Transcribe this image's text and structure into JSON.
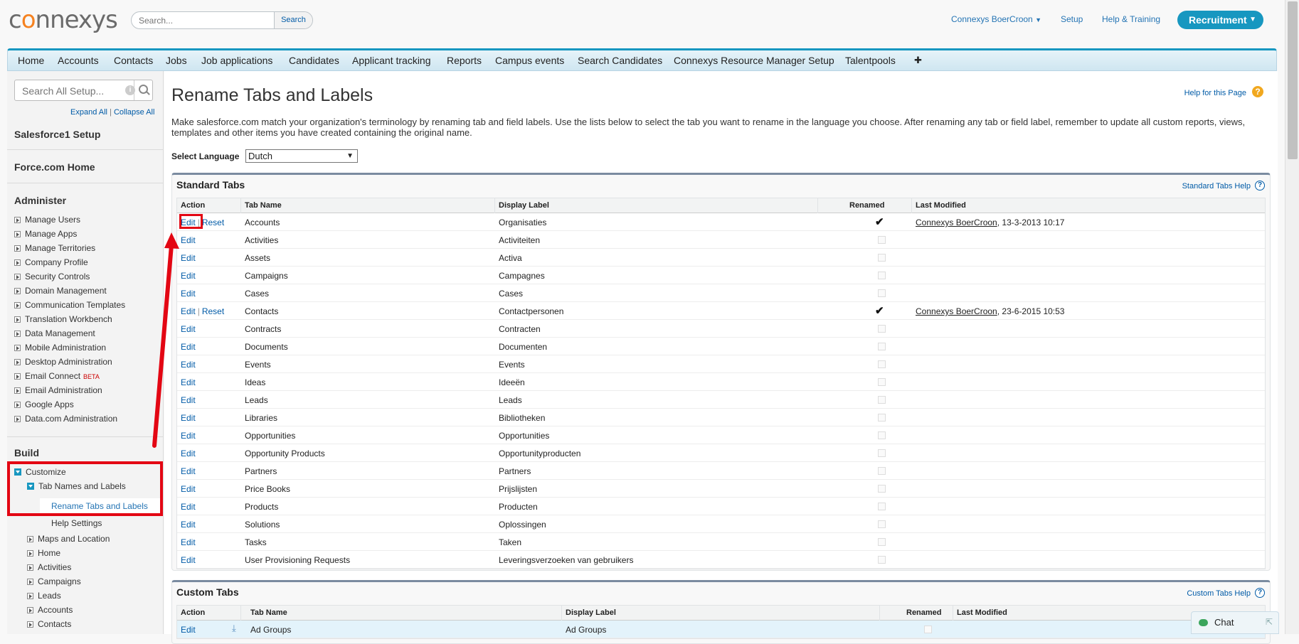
{
  "header": {
    "logo_text": "connexys",
    "search_placeholder": "Search...",
    "search_button": "Search",
    "user_menu": "Connexys BoerCroon",
    "setup": "Setup",
    "help_training": "Help & Training",
    "app_switcher": "Recruitment"
  },
  "tabs": [
    "Home",
    "Accounts",
    "Contacts",
    "Jobs",
    "Job applications",
    "Candidates",
    "Applicant tracking",
    "Reports",
    "Campus events",
    "Search Candidates",
    "Connexys Resource Manager Setup",
    "Talentpools",
    "✚"
  ],
  "sidebar": {
    "search_placeholder": "Search All Setup...",
    "expand_all": "Expand All",
    "collapse_all": "Collapse All",
    "salesforce1": "Salesforce1 Setup",
    "force_home": "Force.com Home",
    "administer_title": "Administer",
    "administer_items": [
      "Manage Users",
      "Manage Apps",
      "Manage Territories",
      "Company Profile",
      "Security Controls",
      "Domain Management",
      "Communication Templates",
      "Translation Workbench",
      "Data Management",
      "Mobile Administration",
      "Desktop Administration",
      "Email Connect",
      "Email Administration",
      "Google Apps",
      "Data.com Administration"
    ],
    "beta_badge": "BETA",
    "build_title": "Build",
    "customize": "Customize",
    "tab_names_labels": "Tab Names and Labels",
    "rename_tabs": "Rename Tabs and Labels",
    "help_settings": "Help Settings",
    "customize_items": [
      "Maps and Location",
      "Home",
      "Activities",
      "Campaigns",
      "Leads",
      "Accounts",
      "Contacts"
    ]
  },
  "main": {
    "title": "Rename Tabs and Labels",
    "help_page": "Help for this Page",
    "intro": "Make salesforce.com match your organization's terminology by renaming tab and field labels. Use the lists below to select the tab you want to rename in the language you choose. After renaming any tab or field label, remember to update all custom reports, views, templates and other items you have created containing the original name.",
    "select_language_label": "Select Language",
    "selected_language": "Dutch"
  },
  "standard_tabs": {
    "title": "Standard Tabs",
    "help": "Standard Tabs Help",
    "columns": [
      "Action",
      "Tab Name",
      "Display Label",
      "Renamed",
      "Last Modified"
    ],
    "edit_label": "Edit",
    "reset_label": "Reset",
    "rows": [
      {
        "tab": "Accounts",
        "label": "Organisaties",
        "renamed": true,
        "modified_by": "Connexys BoerCroon",
        "modified_at": ", 13-3-2013 10:17"
      },
      {
        "tab": "Activities",
        "label": "Activiteiten",
        "renamed": false
      },
      {
        "tab": "Assets",
        "label": "Activa",
        "renamed": false
      },
      {
        "tab": "Campaigns",
        "label": "Campagnes",
        "renamed": false
      },
      {
        "tab": "Cases",
        "label": "Cases",
        "renamed": false
      },
      {
        "tab": "Contacts",
        "label": "Contactpersonen",
        "renamed": true,
        "modified_by": "Connexys BoerCroon",
        "modified_at": ", 23-6-2015 10:53"
      },
      {
        "tab": "Contracts",
        "label": "Contracten",
        "renamed": false
      },
      {
        "tab": "Documents",
        "label": "Documenten",
        "renamed": false
      },
      {
        "tab": "Events",
        "label": "Events",
        "renamed": false
      },
      {
        "tab": "Ideas",
        "label": "Ideeën",
        "renamed": false
      },
      {
        "tab": "Leads",
        "label": "Leads",
        "renamed": false
      },
      {
        "tab": "Libraries",
        "label": "Bibliotheken",
        "renamed": false
      },
      {
        "tab": "Opportunities",
        "label": "Opportunities",
        "renamed": false
      },
      {
        "tab": "Opportunity Products",
        "label": "Opportunityproducten",
        "renamed": false
      },
      {
        "tab": "Partners",
        "label": "Partners",
        "renamed": false
      },
      {
        "tab": "Price Books",
        "label": "Prijslijsten",
        "renamed": false
      },
      {
        "tab": "Products",
        "label": "Producten",
        "renamed": false
      },
      {
        "tab": "Solutions",
        "label": "Oplossingen",
        "renamed": false
      },
      {
        "tab": "Tasks",
        "label": "Taken",
        "renamed": false
      },
      {
        "tab": "User Provisioning Requests",
        "label": "Leveringsverzoeken van gebruikers",
        "renamed": false
      }
    ]
  },
  "custom_tabs": {
    "title": "Custom Tabs",
    "help": "Custom Tabs Help",
    "columns": [
      "Action",
      "Tab Name",
      "Display Label",
      "Renamed",
      "Last Modified"
    ],
    "rows": [
      {
        "edit": "Edit",
        "tab": "Ad Groups",
        "label": "Ad Groups"
      }
    ]
  },
  "chat": {
    "label": "Chat"
  },
  "colors": {
    "accent": "#1797c0",
    "highlight": "#e30613",
    "link": "#015ba7"
  }
}
